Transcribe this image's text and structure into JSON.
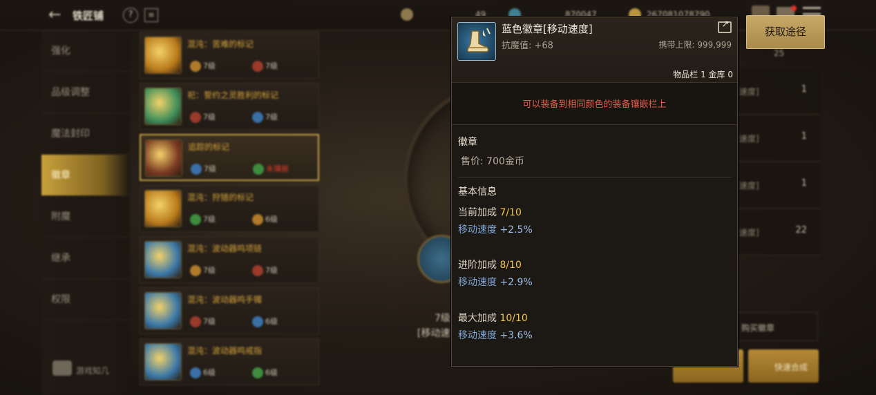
{
  "topbar": {
    "shop_title": "铁匠铺",
    "currencies": [
      "49",
      "870047",
      "267081078790"
    ]
  },
  "sidebar": {
    "items": [
      {
        "label": "强化"
      },
      {
        "label": "品级调整"
      },
      {
        "label": "魔法封印"
      },
      {
        "label": "徽章"
      },
      {
        "label": "附魔"
      },
      {
        "label": "继承"
      },
      {
        "label": "权限"
      }
    ],
    "active_index": 3,
    "brand": "游戏知几"
  },
  "item_list": [
    {
      "name": "混沌：苦难的标记",
      "lvl_a": "7级",
      "lvl_b": "7级",
      "thumb": "#b97a1c"
    },
    {
      "name": "祀：誓约之灵胜利的标记",
      "lvl_a": "7级",
      "lvl_b": "7级",
      "thumb": "#3f8f5a"
    },
    {
      "name": "追踪的标记",
      "lvl_a": "7级",
      "lvl_b": "未镶嵌",
      "thumb": "#7a3a22",
      "selected": true
    },
    {
      "name": "混沌：狩猎的标记",
      "lvl_a": "7级",
      "lvl_b": "6级",
      "thumb": "#b97a1c"
    },
    {
      "name": "混沌：波动器鸣项链",
      "lvl_a": "7级",
      "lvl_b": "7级",
      "thumb": "#3a78a8"
    },
    {
      "name": "混沌：波动器鸣手镯",
      "lvl_a": "7级",
      "lvl_b": "6级",
      "thumb": "#3a78a8"
    },
    {
      "name": "混沌：波动器鸣戒指",
      "lvl_a": "6级",
      "lvl_b": "6级",
      "thumb": "#3a78a8"
    }
  ],
  "center": {
    "level": "7级",
    "subtitle": "[移动速"
  },
  "right_panel": {
    "count": "25",
    "rows": [
      {
        "tag": "速度]",
        "num": "1"
      },
      {
        "tag": "速度]",
        "num": "1"
      },
      {
        "tag": "速度]",
        "num": "1"
      },
      {
        "tag": "速度]",
        "num": "22"
      }
    ],
    "buy_label": "购买徽章",
    "quick_label": "快速合成"
  },
  "tooltip": {
    "name": "蓝色徽章[移动速度]",
    "resist": "抗魔值: +68",
    "carry_limit": "携带上限: 999,999",
    "inventory": "物品栏 1 金库 0",
    "warning": "可以装备到相同颜色的装备镶嵌栏上",
    "category": "徽章",
    "price": "售价: 700金币",
    "basic_info_title": "基本信息",
    "current_label": "当前加成",
    "current_value": "7/10",
    "current_stat_label": "移动速度",
    "current_stat_value": "+2.5%",
    "advanced_label": "进阶加成",
    "advanced_value": "8/10",
    "advanced_stat_label": "移动速度",
    "advanced_stat_value": "+2.9%",
    "max_label": "最大加成",
    "max_value": "10/10",
    "max_stat_label": "移动速度",
    "max_stat_value": "+3.6%"
  },
  "acquire_button": "获取途径",
  "colors": {
    "gold": "#c8a865",
    "warning_red": "#e25a4a",
    "stat_blue": "#7fa5d6",
    "value_yellow": "#f3c64a"
  }
}
